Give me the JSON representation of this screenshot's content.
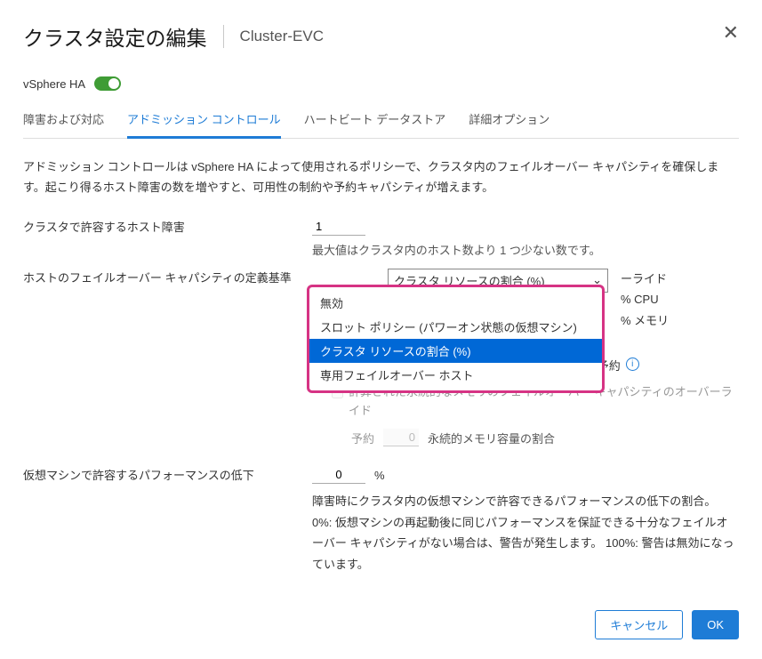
{
  "header": {
    "title": "クラスタ設定の編集",
    "subtitle": "Cluster-EVC"
  },
  "toggle": {
    "label": "vSphere HA"
  },
  "tabs": {
    "failures": "障害および対応",
    "admission": "アドミッション コントロール",
    "heartbeat": "ハートビート データストア",
    "advanced": "詳細オプション"
  },
  "desc": "アドミッション コントロールは vSphere HA によって使用されるポリシーで、クラスタ内のフェイルオーバー キャパシティを確保します。起こり得るホスト障害の数を増やすと、可用性の制約や予約キャパシティが増えます。",
  "hostFailures": {
    "label": "クラスタで許容するホスト障害",
    "value": "1",
    "hint": "最大値はクラスタ内のホスト数より 1 つ少ない数です。"
  },
  "capacityDef": {
    "label": "ホストのフェイルオーバー キャパシティの定義基準",
    "selected": "クラスタ リソースの割合 (%)",
    "options": {
      "disabled": "無効",
      "slot": "スロット ポリシー (パワーオン状態の仮想マシン)",
      "percentage": "クラスタ リソースの割合 (%)",
      "dedicated": "専用フェイルオーバー ホスト"
    }
  },
  "obscured": {
    "line1_suffix": "ーライド",
    "line2_suffix": "% CPU",
    "line3_suffix": "% メモリ"
  },
  "memFailover": {
    "label": "永続的なメモリのフェイルオーバー キャパシティの予約",
    "sub": "計算された永続的なメモリのフェイルオーバー キャパシティのオーバーライド",
    "reserveLabel": "予約",
    "reserveValue": "0",
    "reserveSuffix": "永続的メモリ容量の割合"
  },
  "perf": {
    "label": "仮想マシンで許容するパフォーマンスの低下",
    "value": "0",
    "suffix": "%",
    "desc": "障害時にクラスタ内の仮想マシンで許容できるパフォーマンスの低下の割合。 0%: 仮想マシンの再起動後に同じパフォーマンスを保証できる十分なフェイルオーバー キャパシティがない場合は、警告が発生します。 100%: 警告は無効になっています。"
  },
  "footer": {
    "cancel": "キャンセル",
    "ok": "OK"
  }
}
